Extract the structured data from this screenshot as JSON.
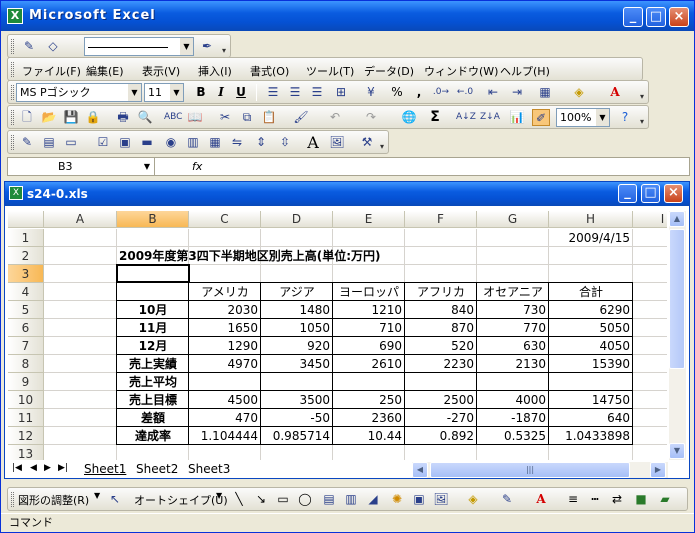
{
  "window": {
    "title": "Microsoft Excel",
    "app_icon": "X"
  },
  "workbook": {
    "title": "s24-0.xls"
  },
  "menu": [
    "ファイル(F)",
    "編集(E)",
    "表示(V)",
    "挿入(I)",
    "書式(O)",
    "ツール(T)",
    "データ(D)",
    "ウィンドウ(W)",
    "ヘルプ(H)"
  ],
  "font": {
    "name": "MS Pゴシック",
    "size": "11",
    "bold": "B",
    "italic": "I",
    "underline": "U",
    "percent": "%",
    "comma": ","
  },
  "zoom": "100%",
  "namebox": "B3",
  "fx": "fx",
  "autosum": "Σ",
  "text_tool": "A",
  "columns": [
    "A",
    "B",
    "C",
    "D",
    "E",
    "F",
    "G",
    "H",
    "I"
  ],
  "rows": [
    "1",
    "2",
    "3",
    "4",
    "5",
    "6",
    "7",
    "8",
    "9",
    "10",
    "11",
    "12",
    "13"
  ],
  "sheet": {
    "date": "2009/4/15",
    "title": "2009年度第3四下半期地区別売上高(単位:万円)",
    "headers": [
      "アメリカ",
      "アジア",
      "ヨーロッパ",
      "アフリカ",
      "オセアニア",
      "合計"
    ],
    "data_rows": [
      {
        "label": "10月",
        "values": [
          "2030",
          "1480",
          "1210",
          "840",
          "730",
          "6290"
        ]
      },
      {
        "label": "11月",
        "values": [
          "1650",
          "1050",
          "710",
          "870",
          "770",
          "5050"
        ]
      },
      {
        "label": "12月",
        "values": [
          "1290",
          "920",
          "690",
          "520",
          "630",
          "4050"
        ]
      },
      {
        "label": "売上実績",
        "values": [
          "4970",
          "3450",
          "2610",
          "2230",
          "2130",
          "15390"
        ]
      },
      {
        "label": "売上平均",
        "values": [
          "",
          "",
          "",
          "",
          "",
          ""
        ]
      },
      {
        "label": "売上目標",
        "values": [
          "4500",
          "3500",
          "250",
          "2500",
          "4000",
          "14750"
        ]
      },
      {
        "label": "差額",
        "values": [
          "470",
          "-50",
          "2360",
          "-270",
          "-1870",
          "640"
        ]
      },
      {
        "label": "達成率",
        "values": [
          "1.104444",
          "0.985714",
          "10.44",
          "0.892",
          "0.5325",
          "1.0433898"
        ]
      }
    ]
  },
  "tabs": [
    "Sheet1",
    "Sheet2",
    "Sheet3"
  ],
  "drawing": {
    "adjust": "図形の調整(R)",
    "autoshape": "オートシェイプ(U)"
  },
  "status": "コマンド",
  "colors": {
    "titlebar": "#0a5ce0",
    "selected_header": "#f8b855",
    "excel_green": "#1f8a3b"
  }
}
